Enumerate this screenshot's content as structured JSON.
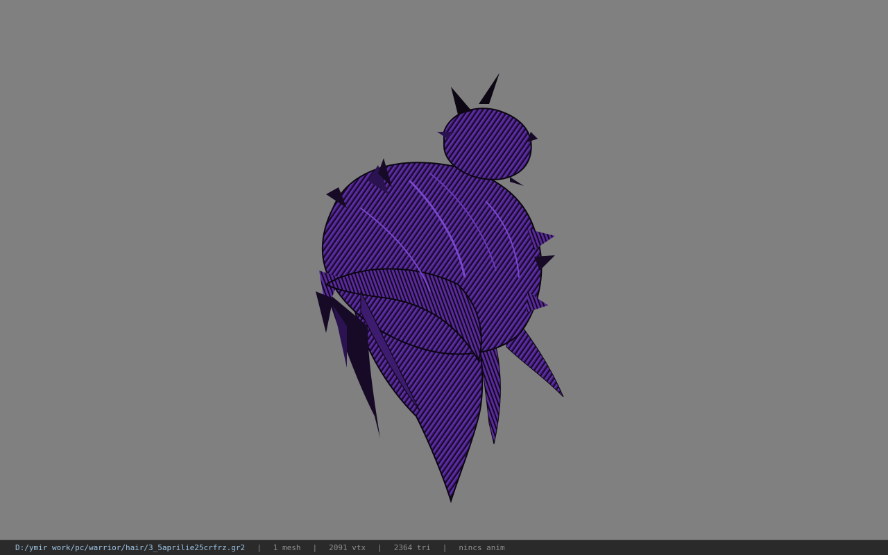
{
  "viewport": {
    "background_color": "#808080",
    "model": {
      "name": "hair-mesh-icon",
      "hair_color": "#5a2a9c",
      "shadow_color": "#0d0714"
    }
  },
  "statusbar": {
    "file_path": "D:/ymir work/pc/warrior/hair/3_5aprilie25crfrz.gr2",
    "separator": "|",
    "mesh_count": "1 mesh",
    "vertex_count": "2091 vtx",
    "triangle_count": "2364 tri",
    "animation": "nincs anim"
  }
}
